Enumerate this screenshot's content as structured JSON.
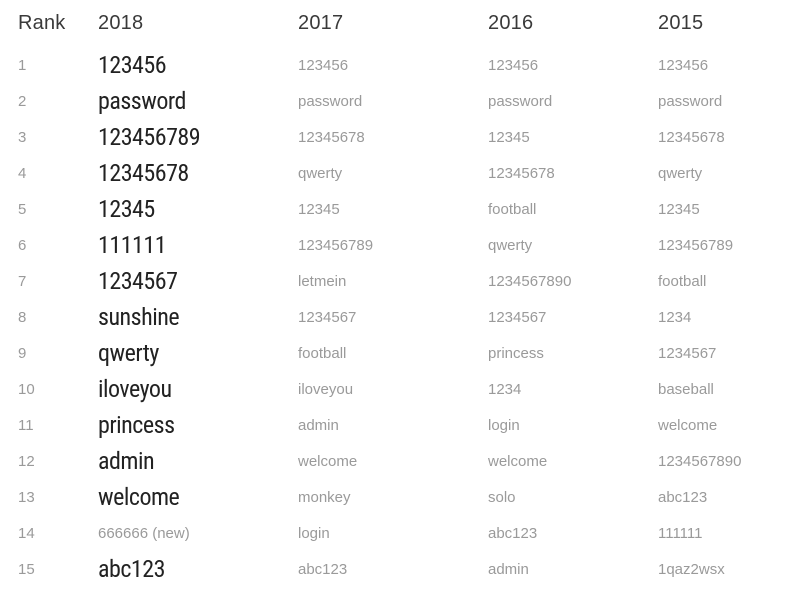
{
  "headers": [
    "Rank",
    "2018",
    "2017",
    "2016",
    "2015"
  ],
  "rows": [
    {
      "rank": "1",
      "c2018": "123456",
      "c2018_bold": true,
      "c2017": "123456",
      "c2016": "123456",
      "c2015": "123456"
    },
    {
      "rank": "2",
      "c2018": "password",
      "c2018_bold": true,
      "c2017": "password",
      "c2016": "password",
      "c2015": "password"
    },
    {
      "rank": "3",
      "c2018": "123456789",
      "c2018_bold": true,
      "c2017": "12345678",
      "c2016": "12345",
      "c2015": "12345678"
    },
    {
      "rank": "4",
      "c2018": "12345678",
      "c2018_bold": true,
      "c2017": "qwerty",
      "c2016": "12345678",
      "c2015": "qwerty"
    },
    {
      "rank": "5",
      "c2018": "12345",
      "c2018_bold": true,
      "c2017": "12345",
      "c2016": "football",
      "c2015": "12345"
    },
    {
      "rank": "6",
      "c2018": "111111",
      "c2018_bold": true,
      "c2017": "123456789",
      "c2016": "qwerty",
      "c2015": "123456789"
    },
    {
      "rank": "7",
      "c2018": "1234567",
      "c2018_bold": true,
      "c2017": "letmein",
      "c2016": "1234567890",
      "c2015": "football"
    },
    {
      "rank": "8",
      "c2018": "sunshine",
      "c2018_bold": true,
      "c2017": "1234567",
      "c2016": "1234567",
      "c2015": "1234"
    },
    {
      "rank": "9",
      "c2018": "qwerty",
      "c2018_bold": true,
      "c2017": "football",
      "c2016": "princess",
      "c2015": "1234567"
    },
    {
      "rank": "10",
      "c2018": "iloveyou",
      "c2018_bold": true,
      "c2017": "iloveyou",
      "c2016": "1234",
      "c2015": "baseball"
    },
    {
      "rank": "11",
      "c2018": "princess",
      "c2018_bold": true,
      "c2017": "admin",
      "c2016": "login",
      "c2015": "welcome"
    },
    {
      "rank": "12",
      "c2018": "admin",
      "c2018_bold": true,
      "c2017": "welcome",
      "c2016": "welcome",
      "c2015": "1234567890"
    },
    {
      "rank": "13",
      "c2018": "welcome",
      "c2018_bold": true,
      "c2017": "monkey",
      "c2016": "solo",
      "c2015": "abc123"
    },
    {
      "rank": "14",
      "c2018": "666666 (new)",
      "c2018_bold": false,
      "c2017": "login",
      "c2016": "abc123",
      "c2015": "111111"
    },
    {
      "rank": "15",
      "c2018": "abc123",
      "c2018_bold": true,
      "c2017": "abc123",
      "c2016": "admin",
      "c2015": "1qaz2wsx"
    }
  ],
  "chart_data": {
    "type": "table",
    "title": "",
    "columns": [
      "Rank",
      "2018",
      "2017",
      "2016",
      "2015"
    ],
    "rows": [
      [
        1,
        "123456",
        "123456",
        "123456",
        "123456"
      ],
      [
        2,
        "password",
        "password",
        "password",
        "password"
      ],
      [
        3,
        "123456789",
        "12345678",
        "12345",
        "12345678"
      ],
      [
        4,
        "12345678",
        "qwerty",
        "12345678",
        "qwerty"
      ],
      [
        5,
        "12345",
        "12345",
        "football",
        "12345"
      ],
      [
        6,
        "111111",
        "123456789",
        "qwerty",
        "123456789"
      ],
      [
        7,
        "1234567",
        "letmein",
        "1234567890",
        "football"
      ],
      [
        8,
        "sunshine",
        "1234567",
        "1234567",
        "1234"
      ],
      [
        9,
        "qwerty",
        "football",
        "princess",
        "1234567"
      ],
      [
        10,
        "iloveyou",
        "iloveyou",
        "1234",
        "baseball"
      ],
      [
        11,
        "princess",
        "admin",
        "login",
        "welcome"
      ],
      [
        12,
        "admin",
        "welcome",
        "welcome",
        "1234567890"
      ],
      [
        13,
        "welcome",
        "monkey",
        "solo",
        "abc123"
      ],
      [
        14,
        "666666 (new)",
        "login",
        "abc123",
        "111111"
      ],
      [
        15,
        "abc123",
        "abc123",
        "admin",
        "1qaz2wsx"
      ]
    ]
  }
}
